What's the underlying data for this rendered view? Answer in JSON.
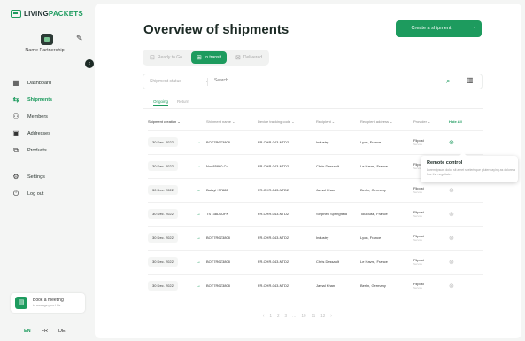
{
  "brand": {
    "logo_text_1": "LIVING",
    "logo_text_2": "PACKETS"
  },
  "account": {
    "name": "Name Partnership"
  },
  "nav": {
    "items": [
      {
        "label": "Dashboard",
        "icon": "grid-icon",
        "glyph": "▦"
      },
      {
        "label": "Shipments",
        "icon": "shipments-icon",
        "glyph": "⇆",
        "active": true
      },
      {
        "label": "Members",
        "icon": "members-icon",
        "glyph": "⚇"
      },
      {
        "label": "Addresses",
        "icon": "addresses-icon",
        "glyph": "▣"
      },
      {
        "label": "Products",
        "icon": "products-icon",
        "glyph": "⧉"
      }
    ],
    "bottom": [
      {
        "label": "Settings",
        "icon": "gear-icon",
        "glyph": "⚙"
      },
      {
        "label": "Log out",
        "icon": "power-icon",
        "glyph": "⏻"
      }
    ]
  },
  "book_meeting": {
    "title": "Book a meeting",
    "subtitle": "to manage your LPs"
  },
  "languages": [
    "EN",
    "FR",
    "DE"
  ],
  "header": {
    "title": "Overview of shipments",
    "create_label": "Create a shipment"
  },
  "status_tabs": [
    {
      "label": "Ready to Go",
      "active": false
    },
    {
      "label": "In transit",
      "active": true
    },
    {
      "label": "Delivered",
      "active": false
    }
  ],
  "filter": {
    "status_placeholder": "Shipment status",
    "search_placeholder": "Search"
  },
  "subtabs": [
    {
      "label": "Ongoing",
      "active": true
    },
    {
      "label": "Return",
      "active": false
    }
  ],
  "table": {
    "columns": [
      "Shipment creation",
      "",
      "Shipment name",
      "Device tracking code",
      "Recipient",
      "Recipient address",
      "Provider",
      "Hide All"
    ],
    "rows": [
      {
        "date": "30 Dec. 2022",
        "name": "BOT7R6Z3808",
        "code": "FR-CHR-043-NTD2",
        "recipient": "Industry",
        "address": "Lyon, France",
        "provider": "Flipost",
        "provider_sub": "Service",
        "active": true
      },
      {
        "date": "30 Dec. 2022",
        "name": "Nou85860 Co",
        "code": "FR-CHR-043-NTD2",
        "recipient": "Chris Dessault",
        "address": "Le Havre, France",
        "provider": "Flipost",
        "provider_sub": "Service",
        "active": false
      },
      {
        "date": "30 Dec. 2022",
        "name": "Batayi+37882",
        "code": "FR-CHR-043-NTD2",
        "recipient": "Jamal Khan",
        "address": "Berlin, Germany",
        "provider": "Flipost",
        "provider_sub": "Service",
        "active": false
      },
      {
        "date": "30 Dec. 2022",
        "name": "TST38D1UFK",
        "code": "FR-CHR-043-NTD2",
        "recipient": "Stephen Springfield",
        "address": "Toulouse, France",
        "provider": "Flipost",
        "provider_sub": "Service",
        "active": false
      },
      {
        "date": "30 Dec. 2022",
        "name": "BOT7R6Z3808",
        "code": "FR-CHR-043-NTD2",
        "recipient": "Industry",
        "address": "Lyon, France",
        "provider": "Flipost",
        "provider_sub": "Service",
        "active": false
      },
      {
        "date": "30 Dec. 2022",
        "name": "BOT7R6Z3808",
        "code": "FR-CHR-043-NTD2",
        "recipient": "Chris Dessault",
        "address": "Le Havre, France",
        "provider": "Flipost",
        "provider_sub": "Service",
        "active": false
      },
      {
        "date": "30 Dec. 2022",
        "name": "BOT7R6Z3808",
        "code": "FR-CHR-043-NTD2",
        "recipient": "Jamal Khan",
        "address": "Berlin, Germany",
        "provider": "Flipost",
        "provider_sub": "Service",
        "active": false
      }
    ]
  },
  "tooltip": {
    "title": "Remote control",
    "body": "Lorem ipsum dolor sit amet scelerisque glutenpaying as dolore a fine the negotiate."
  },
  "pager": [
    "‹",
    "1",
    "2",
    "3",
    "…",
    "10",
    "11",
    "12",
    "›"
  ],
  "colors": {
    "accent": "#1d9b5e"
  }
}
